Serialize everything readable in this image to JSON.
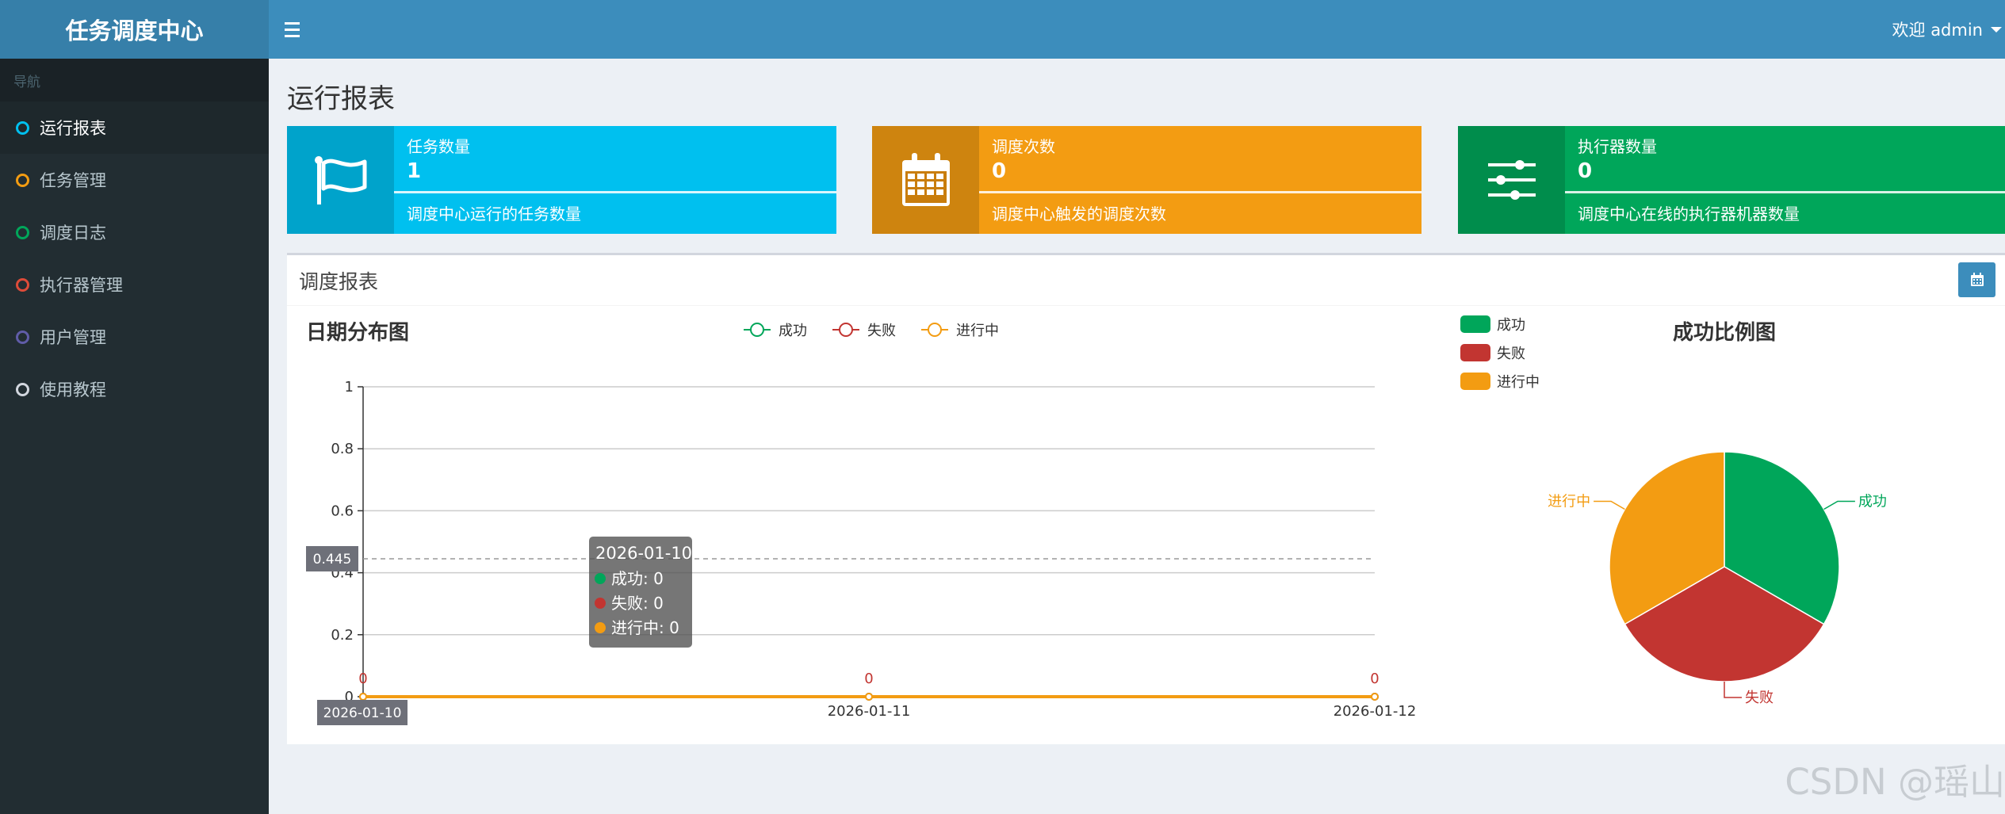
{
  "header": {
    "logo": "任务调度中心",
    "user": "欢迎 admin"
  },
  "sidebar": {
    "header": "导航",
    "items": [
      {
        "label": "运行报表",
        "color": "#00c0ef"
      },
      {
        "label": "任务管理",
        "color": "#f39c12"
      },
      {
        "label": "调度日志",
        "color": "#00a65a"
      },
      {
        "label": "执行器管理",
        "color": "#dd4b39"
      },
      {
        "label": "用户管理",
        "color": "#605ca8"
      },
      {
        "label": "使用教程",
        "color": "#d2d6de"
      }
    ]
  },
  "page": {
    "title": "运行报表"
  },
  "stats": [
    {
      "label": "任务数量",
      "value": "1",
      "desc": "调度中心运行的任务数量",
      "color": "#00c0ef",
      "icon": "flag-icon"
    },
    {
      "label": "调度次数",
      "value": "0",
      "desc": "调度中心触发的调度次数",
      "color": "#f39c12",
      "icon": "calendar-icon"
    },
    {
      "label": "执行器数量",
      "value": "0",
      "desc": "调度中心在线的执行器机器数量",
      "color": "#00a65a",
      "icon": "sliders-icon"
    }
  ],
  "report": {
    "title": "调度报表"
  },
  "chart_data": [
    {
      "type": "line",
      "title": "日期分布图",
      "x": [
        "2026-01-10",
        "2026-01-11",
        "2026-01-12"
      ],
      "series": [
        {
          "name": "成功",
          "values": [
            0,
            0,
            0
          ],
          "color": "#00a65a"
        },
        {
          "name": "失败",
          "values": [
            0,
            0,
            0
          ],
          "color": "#c23531"
        },
        {
          "name": "进行中",
          "values": [
            0,
            0,
            0
          ],
          "color": "#f39c12"
        }
      ],
      "data_labels": [
        "0",
        "0",
        "0"
      ],
      "ylim": [
        0,
        1
      ],
      "yticks": [
        "0",
        "0.2",
        "0.4",
        "0.6",
        "0.8",
        "1"
      ],
      "grid": true,
      "legend": "top-center",
      "crosshair": {
        "y_label": "0.445",
        "x_label": "2026-01-10"
      },
      "tooltip": {
        "title": "2026-01-10",
        "rows": [
          "成功: 0",
          "失败: 0",
          "进行中: 0"
        ]
      }
    },
    {
      "type": "pie",
      "title": "成功比例图",
      "categories": [
        "成功",
        "失败",
        "进行中"
      ],
      "values": [
        1,
        1,
        1
      ],
      "colors": [
        "#00a65a",
        "#c23531",
        "#f39c12"
      ],
      "legend": "top-left"
    }
  ],
  "watermark": "CSDN @瑶山"
}
